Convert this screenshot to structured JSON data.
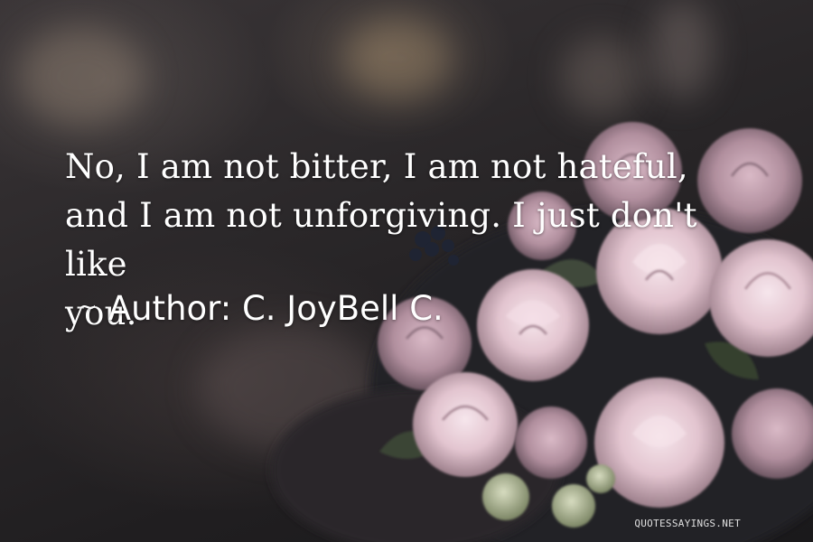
{
  "quote": {
    "lines": [
      "No, I am not bitter, I am not hateful,",
      "and I am not unforgiving. I just don't like",
      "you."
    ]
  },
  "attribution": {
    "prefix": "~",
    "author_label": "Author: C. JoyBell C."
  },
  "watermark": "QUOTESSAYINGS.NET",
  "colors": {
    "text": "#ffffff",
    "background": "#2a2729",
    "rose": "#e9cdd6",
    "leaf": "#3f4a3a"
  }
}
